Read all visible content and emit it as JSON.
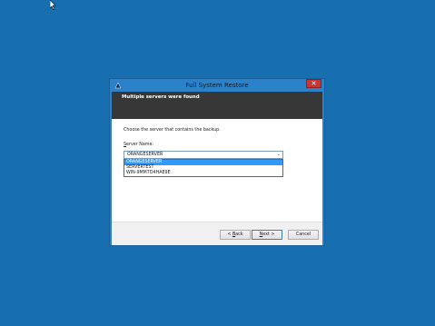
{
  "window": {
    "title": "Full System Restore"
  },
  "header": {
    "heading": "Multiple servers were found"
  },
  "content": {
    "instruction": "Choose the server that contains the backup.",
    "server_label": "Server Name:",
    "selected_value": "ORANGESERVER",
    "options": [
      "ORANGESERVER",
      "SERVERTEST",
      "WIN-9MM7D4HAE9E"
    ]
  },
  "buttons": {
    "back": "< Back",
    "next": "Next >",
    "cancel": "Cancel"
  },
  "icons": {
    "close": "close-icon",
    "dropdown": "chevron-down-icon"
  },
  "colors": {
    "desktop": "#176faf",
    "header_band": "#373737",
    "selection": "#3399ff",
    "close_button": "#c7372f"
  }
}
